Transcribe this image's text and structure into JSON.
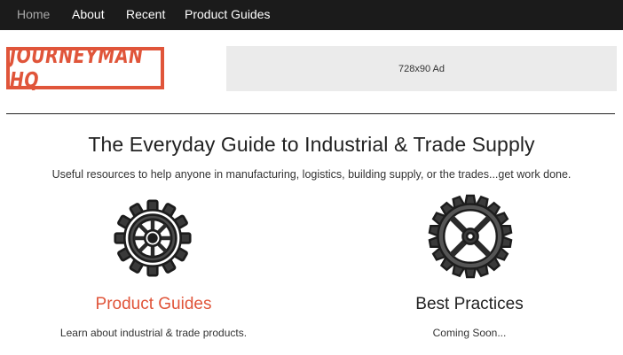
{
  "nav": {
    "items": [
      {
        "label": "Home"
      },
      {
        "label": "About"
      },
      {
        "label": "Recent"
      },
      {
        "label": "Product Guides"
      }
    ]
  },
  "brand": {
    "logo_text": "JOURNEYMAN HQ",
    "accent_color": "#e0553a"
  },
  "ad": {
    "label": "728x90 Ad"
  },
  "hero": {
    "title": "The Everyday Guide to Industrial & Trade Supply",
    "subtitle": "Useful resources to help anyone in manufacturing, logistics, building supply, or the trades...get work done."
  },
  "cards": [
    {
      "icon": "gear-icon",
      "title": "Product Guides",
      "description": "Learn about industrial & trade products."
    },
    {
      "icon": "gear-icon",
      "title": "Best Practices",
      "description": "Coming Soon..."
    }
  ]
}
